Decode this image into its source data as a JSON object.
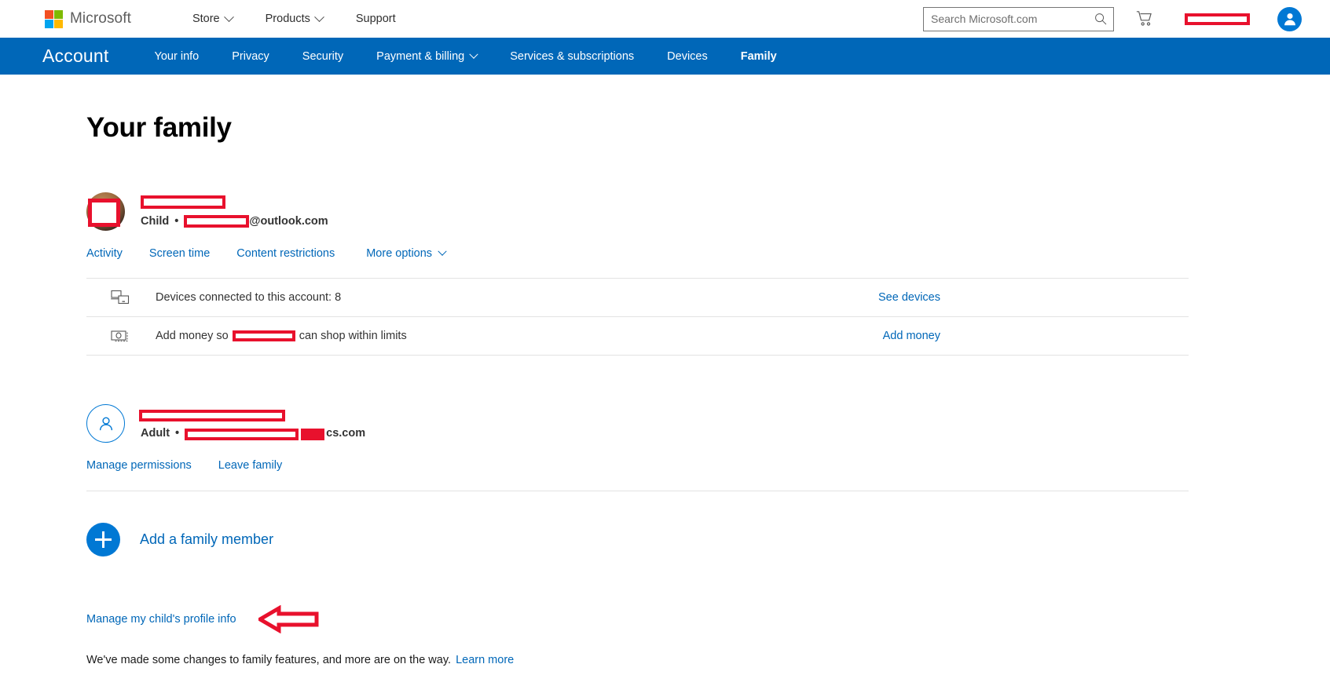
{
  "header": {
    "brand": "Microsoft",
    "nav": [
      {
        "label": "Store",
        "has_chevron": true
      },
      {
        "label": "Products",
        "has_chevron": true
      },
      {
        "label": "Support",
        "has_chevron": false
      }
    ],
    "search": {
      "placeholder": "Search Microsoft.com",
      "value": "",
      "icon": "search-icon"
    },
    "cart_icon": "shopping-cart-icon",
    "account_redacted": true,
    "avatar_icon": "user-avatar-icon"
  },
  "account_nav": {
    "brand": "Account",
    "items": [
      {
        "label": "Your info",
        "active": false,
        "has_chevron": false
      },
      {
        "label": "Privacy",
        "active": false,
        "has_chevron": false
      },
      {
        "label": "Security",
        "active": false,
        "has_chevron": false
      },
      {
        "label": "Payment & billing",
        "active": false,
        "has_chevron": true
      },
      {
        "label": "Services & subscriptions",
        "active": false,
        "has_chevron": false
      },
      {
        "label": "Devices",
        "active": false,
        "has_chevron": false
      },
      {
        "label": "Family",
        "active": true,
        "has_chevron": false
      }
    ]
  },
  "main": {
    "title": "Your family",
    "members": [
      {
        "avatar_type": "photo",
        "name_redacted": true,
        "role": "Child",
        "separator": "•",
        "email_suffix": "@outlook.com",
        "email_redacted": true,
        "links": [
          {
            "label": "Activity",
            "has_chevron": false
          },
          {
            "label": "Screen time",
            "has_chevron": false
          },
          {
            "label": "Content restrictions",
            "has_chevron": false
          },
          {
            "label": "More options",
            "has_chevron": true
          }
        ],
        "info_rows": [
          {
            "icon": "devices-icon",
            "label_before": "Devices connected to this account: 8",
            "label_after": "",
            "redacted_inline": false,
            "action": "See devices"
          },
          {
            "icon": "money-icon",
            "label_before": "Add money so",
            "label_after": "can shop within limits",
            "redacted_inline": true,
            "action": "Add money"
          }
        ]
      },
      {
        "avatar_type": "outline",
        "name_redacted": true,
        "role": "Adult",
        "separator": "•",
        "email_suffix": "cs.com",
        "email_redacted": true,
        "links": [
          {
            "label": "Manage permissions",
            "has_chevron": false
          },
          {
            "label": "Leave family",
            "has_chevron": false
          }
        ],
        "info_rows": []
      }
    ],
    "add_member_label": "Add a family member",
    "add_member_icon": "plus-icon",
    "manage_profile_link": "Manage my child's profile info",
    "annotation_arrow": "red-left-arrow-icon",
    "footer_text": "We've made some changes to family features, and more are on the way.",
    "footer_link": "Learn more"
  },
  "colors": {
    "ms_blue": "#0067b8",
    "link_blue": "#0078d4",
    "redaction_red": "#e8112d",
    "nav_bg": "#0067b8"
  }
}
